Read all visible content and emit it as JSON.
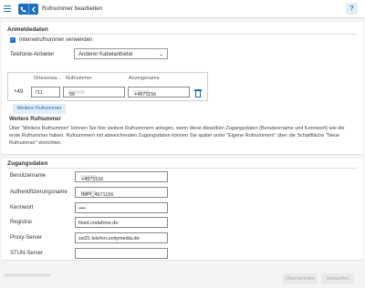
{
  "header": {
    "title": "Rufnummer bearbeiten",
    "help_label": "?"
  },
  "section_registration": {
    "title": "Anmeldedaten",
    "checkbox_label": "Internetrufnummer verwenden",
    "checkbox_checked": true,
    "provider_label": "Telefonie-Anbieter",
    "provider_value": "Anderer Kabelanbieter",
    "table": {
      "col_area": "Ortsvorwa...",
      "col_number": "Rufnummer",
      "col_display": "Anzeigename",
      "prefix": "+49",
      "area_value": "711",
      "number_value": "56",
      "display_value": "+4971156"
    },
    "more_button": "Weitere Rufnummer",
    "more_title": "Weitere Rufnummer",
    "more_text": "Über \"Weitere Rufnummer\" können Sie hier weitere Rufnummern anlegen, wenn diese dieselben Zugangsdaten (Benutzername und Kennwort) wie die erste Rufnummer haben. Rufnummern mit abweichenden Zugangsdaten können Sie später unter \"Eigene Rufnummern\" über die Schaltfläche \"Neue Rufnummer\" einrichten."
  },
  "section_access": {
    "title": "Zugangsdaten",
    "username_label": "Benutzername",
    "username_value": "+4971156",
    "auth_label": "Authentifizierungsname",
    "auth_value": "IMPI_4971156",
    "password_label": "Kennwort",
    "password_value": "••••",
    "registrar_label": "Registrar",
    "registrar_value": "fixed.vodafone.de",
    "proxy_label": "Proxy-Server",
    "proxy_value": "ssl31.telefon.unitymedia.de",
    "stun_label": "STUN-Server",
    "stun_value": ""
  },
  "footer": {
    "apply_label": "Übernehmen",
    "discard_label": "Verwerfen"
  },
  "colors": {
    "accent": "#1a6fbf",
    "background": "#f4f4f4"
  }
}
